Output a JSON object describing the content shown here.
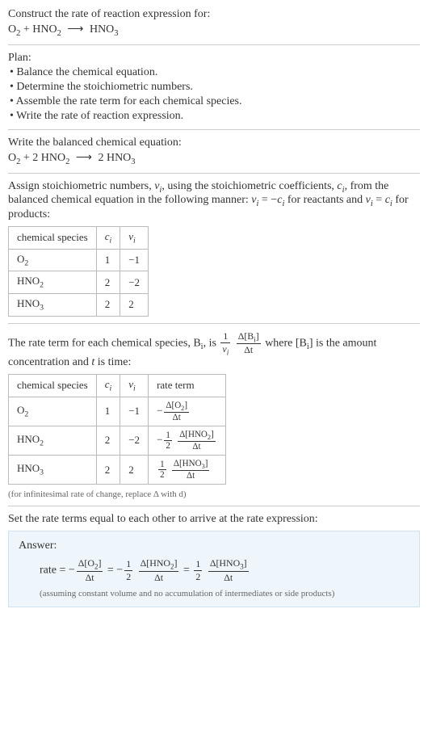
{
  "header": {
    "prompt": "Construct the rate of reaction expression for:",
    "equation_lhs1": "O",
    "equation_lhs1_sub": "2",
    "plus1": " + ",
    "equation_lhs2": "HNO",
    "equation_lhs2_sub": "2",
    "arrow": "⟶",
    "equation_rhs": "HNO",
    "equation_rhs_sub": "3"
  },
  "plan": {
    "title": "Plan:",
    "items": [
      "• Balance the chemical equation.",
      "• Determine the stoichiometric numbers.",
      "• Assemble the rate term for each chemical species.",
      "• Write the rate of reaction expression."
    ]
  },
  "balanced": {
    "intro": "Write the balanced chemical equation:",
    "o2": "O",
    "o2_sub": "2",
    "plus": " + 2 ",
    "hno2": "HNO",
    "hno2_sub": "2",
    "arrow": "⟶",
    "rhs_coef": " 2 ",
    "hno3": "HNO",
    "hno3_sub": "3"
  },
  "assign": {
    "text_a": "Assign stoichiometric numbers, ",
    "nu_i": "ν",
    "nu_i_sub": "i",
    "text_b": ", using the stoichiometric coefficients, ",
    "c_i": "c",
    "c_i_sub": "i",
    "text_c": ", from the balanced chemical equation in the following manner: ",
    "eq1_lhs": "ν",
    "eq1_lhs_sub": "i",
    "eq1_mid": " = −",
    "eq1_rhs": "c",
    "eq1_rhs_sub": "i",
    "text_d": " for reactants and ",
    "eq2_lhs": "ν",
    "eq2_lhs_sub": "i",
    "eq2_mid": " = ",
    "eq2_rhs": "c",
    "eq2_rhs_sub": "i",
    "text_e": " for products:"
  },
  "table1": {
    "h1": "chemical species",
    "h2": "c",
    "h2_sub": "i",
    "h3": "ν",
    "h3_sub": "i",
    "rows": [
      {
        "sp": "O",
        "sp_sub": "2",
        "c": "1",
        "v": "−1"
      },
      {
        "sp": "HNO",
        "sp_sub": "2",
        "c": "2",
        "v": "−2"
      },
      {
        "sp": "HNO",
        "sp_sub": "3",
        "c": "2",
        "v": "2"
      }
    ]
  },
  "rateterm": {
    "text_a": "The rate term for each chemical species, B",
    "bi_sub": "i",
    "text_b": ", is ",
    "frac1_num": "1",
    "frac1_den_a": "ν",
    "frac1_den_sub": "i",
    "frac2_num_a": "Δ[B",
    "frac2_num_sub": "i",
    "frac2_num_b": "]",
    "frac2_den": "Δt",
    "text_c": " where [B",
    "text_c_sub": "i",
    "text_d": "] is the amount concentration and ",
    "t": "t",
    "text_e": " is time:"
  },
  "table2": {
    "h1": "chemical species",
    "h2": "c",
    "h2_sub": "i",
    "h3": "ν",
    "h3_sub": "i",
    "h4": "rate term",
    "rows": [
      {
        "sp": "O",
        "sp_sub": "2",
        "c": "1",
        "v": "−1",
        "sign": "−",
        "half": "",
        "num": "Δ[O",
        "num_sub": "2",
        "num_b": "]",
        "den": "Δt"
      },
      {
        "sp": "HNO",
        "sp_sub": "2",
        "c": "2",
        "v": "−2",
        "sign": "−",
        "half": "½",
        "half_num": "1",
        "half_den": "2",
        "num": "Δ[HNO",
        "num_sub": "2",
        "num_b": "]",
        "den": "Δt"
      },
      {
        "sp": "HNO",
        "sp_sub": "3",
        "c": "2",
        "v": "2",
        "sign": "",
        "half_num": "1",
        "half_den": "2",
        "num": "Δ[HNO",
        "num_sub": "3",
        "num_b": "]",
        "den": "Δt"
      }
    ],
    "note": "(for infinitesimal rate of change, replace Δ with d)"
  },
  "final": {
    "intro": "Set the rate terms equal to each other to arrive at the rate expression:"
  },
  "answer": {
    "label": "Answer:",
    "rate": "rate = −",
    "t1_num": "Δ[O",
    "t1_num_sub": "2",
    "t1_num_b": "]",
    "t1_den": "Δt",
    "eq1": " = −",
    "half_num": "1",
    "half_den": "2",
    "t2_num": "Δ[HNO",
    "t2_num_sub": "2",
    "t2_num_b": "]",
    "t2_den": "Δt",
    "eq2": " = ",
    "t3_num": "Δ[HNO",
    "t3_num_sub": "3",
    "t3_num_b": "]",
    "t3_den": "Δt",
    "assume": "(assuming constant volume and no accumulation of intermediates or side products)"
  },
  "chart_data": {
    "type": "table",
    "tables": [
      {
        "title": "Stoichiometric numbers",
        "columns": [
          "chemical species",
          "c_i",
          "ν_i"
        ],
        "rows": [
          [
            "O2",
            1,
            -1
          ],
          [
            "HNO2",
            2,
            -2
          ],
          [
            "HNO3",
            2,
            2
          ]
        ]
      },
      {
        "title": "Rate terms",
        "columns": [
          "chemical species",
          "c_i",
          "ν_i",
          "rate term"
        ],
        "rows": [
          [
            "O2",
            1,
            -1,
            "-Δ[O2]/Δt"
          ],
          [
            "HNO2",
            2,
            -2,
            "-(1/2) Δ[HNO2]/Δt"
          ],
          [
            "HNO3",
            2,
            2,
            "(1/2) Δ[HNO3]/Δt"
          ]
        ]
      }
    ]
  }
}
